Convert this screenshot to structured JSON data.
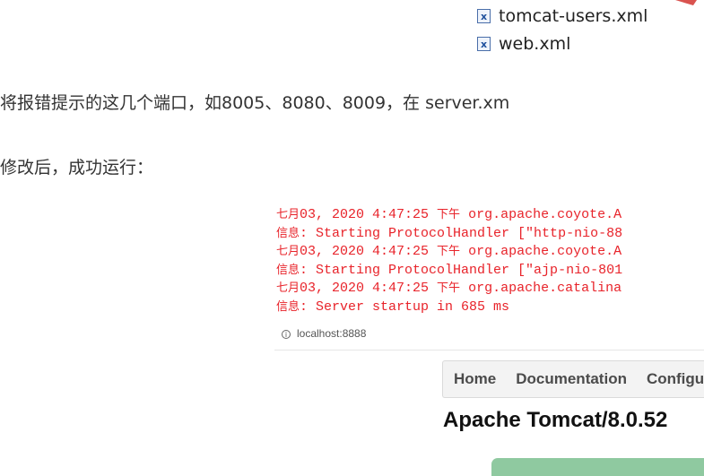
{
  "files": [
    {
      "icon": "xml-file-icon",
      "name": "tomcat-users.xml"
    },
    {
      "icon": "xml-file-icon",
      "name": "web.xml"
    }
  ],
  "paragraphs": {
    "p1": "将报错提示的这几个端口，如8005、8080、8009，在 server.xm",
    "p2": "修改后，成功运行："
  },
  "console": {
    "lines": [
      {
        "prefix": "七月",
        "text": "03, 2020 4:47:25 ",
        "cjk": "下午",
        "rest": " org.apache.coyote.A"
      },
      {
        "prefix": "信息",
        "text": ": Starting ProtocolHandler [\"http-nio-88",
        "cjk": "",
        "rest": ""
      },
      {
        "prefix": "七月",
        "text": "03, 2020 4:47:25 ",
        "cjk": "下午",
        "rest": " org.apache.coyote.A"
      },
      {
        "prefix": "信息",
        "text": ": Starting ProtocolHandler [\"ajp-nio-801",
        "cjk": "",
        "rest": ""
      },
      {
        "prefix": "七月",
        "text": "03, 2020 4:47:25 ",
        "cjk": "下午",
        "rest": " org.apache.catalina"
      },
      {
        "prefix": "信息",
        "text": ": Server startup in 685 ms",
        "cjk": "",
        "rest": ""
      }
    ]
  },
  "browser": {
    "address": "localhost:8888",
    "nav": [
      "Home",
      "Documentation",
      "Configu"
    ],
    "title": "Apache Tomcat/8.0.52"
  },
  "colors": {
    "log_red": "#e8232a",
    "accent_green": "#8fc9a0"
  }
}
